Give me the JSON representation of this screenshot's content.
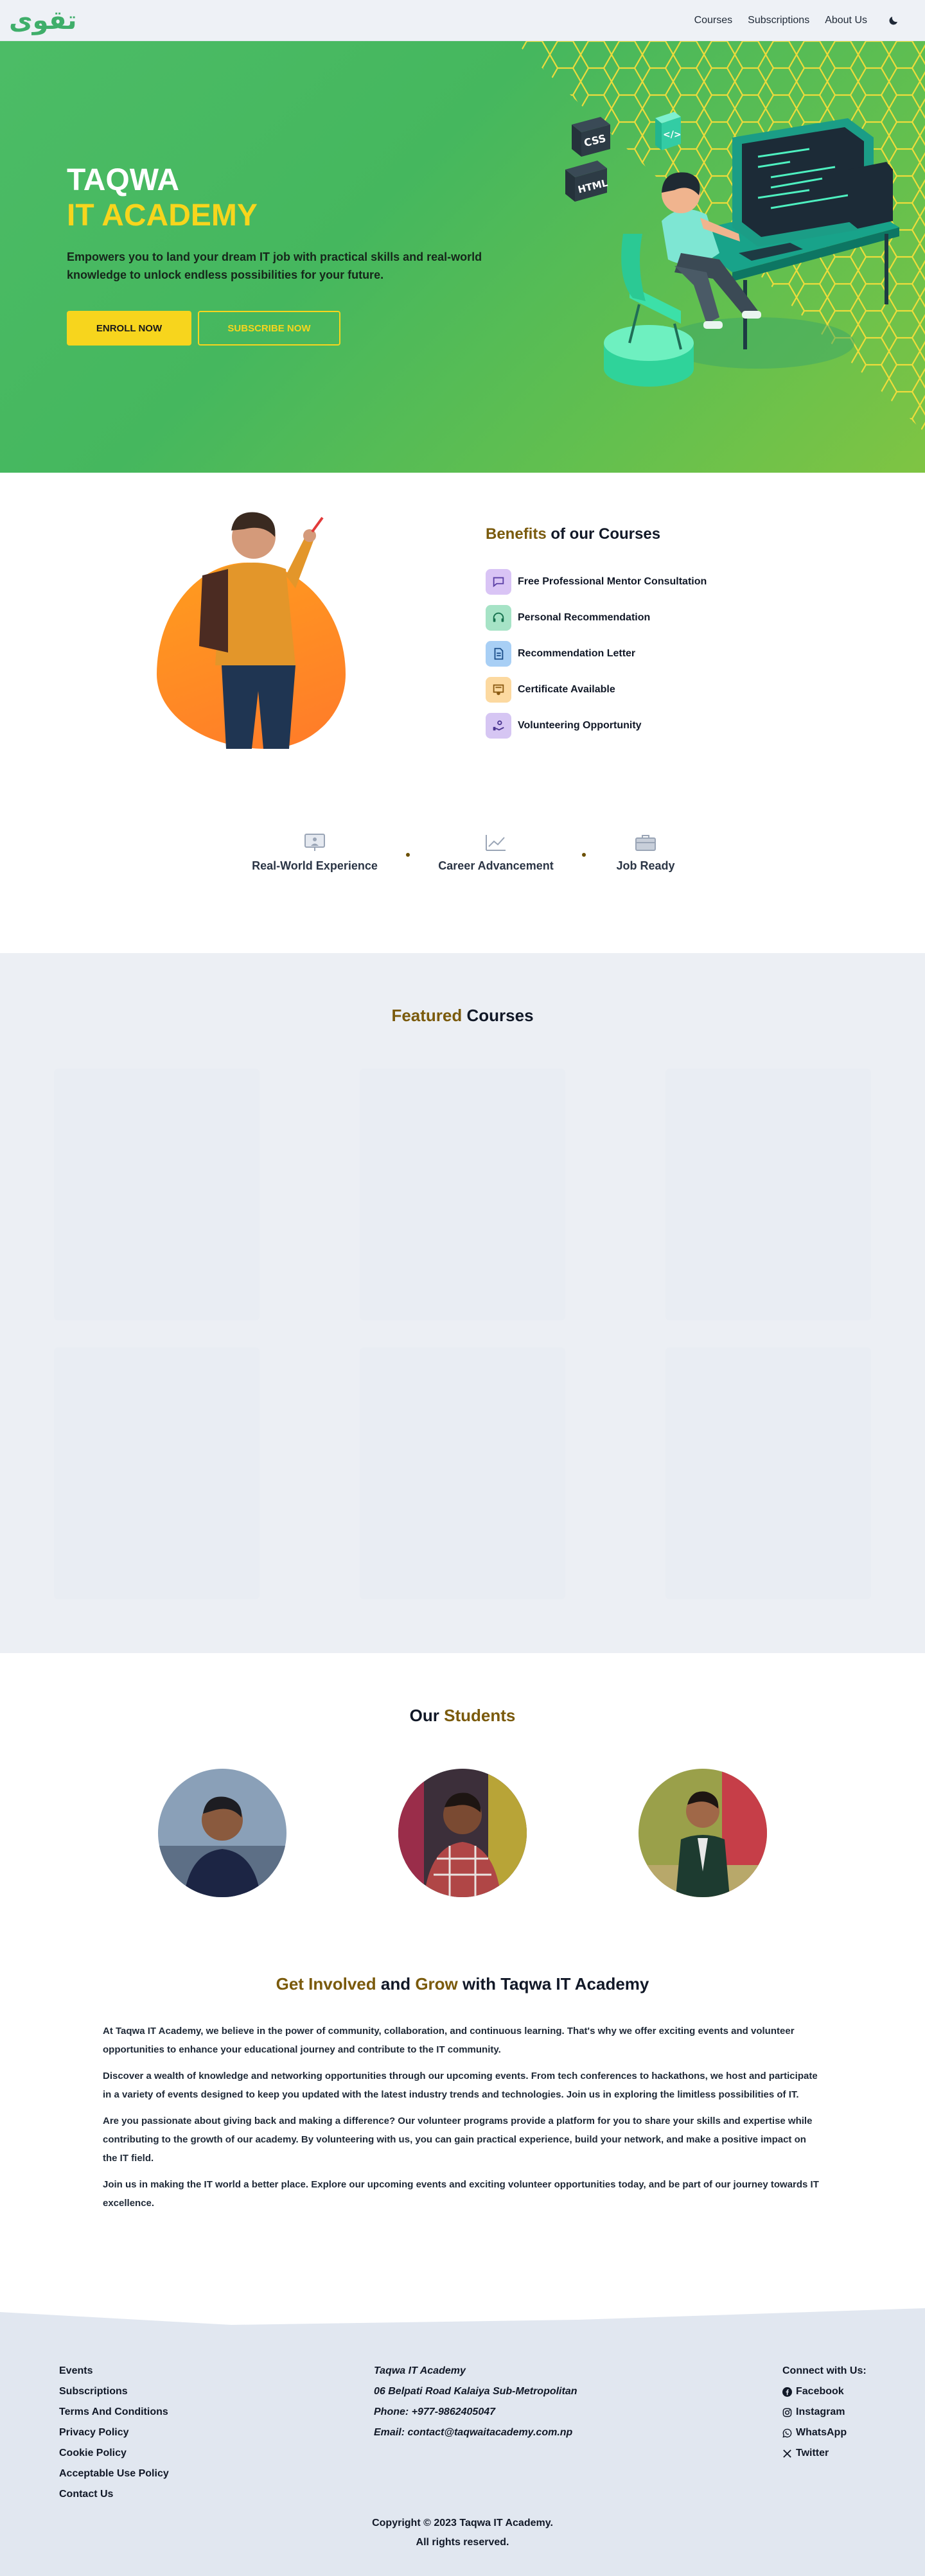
{
  "nav": {
    "logo_text": "تقوى",
    "links": [
      "Courses",
      "Subscriptions",
      "About Us"
    ],
    "theme_toggle_icon": "moon-icon"
  },
  "hero": {
    "title_line1": "TAQWA",
    "title_line2": "IT ACADEMY",
    "description": "Empowers you to land your dream IT job with practical skills and real-world knowledge to unlock endless possibilities for your future.",
    "enroll_label": "ENROLL NOW",
    "subscribe_label": "SUBSCRIBE NOW",
    "illustration_labels": [
      "CSS",
      "HTML",
      "</>"
    ]
  },
  "benefits": {
    "title_accent": "Benefits",
    "title_rest": " of our Courses",
    "items": [
      {
        "label": "Free Professional Mentor Consultation",
        "icon": "chat-icon",
        "color": "#d9c4f5"
      },
      {
        "label": "Personal Recommendation",
        "icon": "headset-icon",
        "color": "#a6e3c6"
      },
      {
        "label": "Recommendation Letter",
        "icon": "document-icon",
        "color": "#a8cff5"
      },
      {
        "label": "Certificate Available",
        "icon": "certificate-icon",
        "color": "#fcd9a0"
      },
      {
        "label": "Volunteering Opportunity",
        "icon": "volunteer-icon",
        "color": "#d6c6f3"
      }
    ]
  },
  "features": [
    {
      "label": "Real-World Experience",
      "icon": "presentation-icon"
    },
    {
      "label": "Career Advancement",
      "icon": "trending-up-icon"
    },
    {
      "label": "Job Ready",
      "icon": "briefcase-icon"
    }
  ],
  "courses": {
    "title_accent": "Featured",
    "title_rest": " Courses"
  },
  "students": {
    "title_plain": "Our ",
    "title_accent": "Students"
  },
  "involved": {
    "title_a": "Get Involved",
    "title_and": " and ",
    "title_b": "Grow",
    "title_rest": " with Taqwa IT Academy",
    "paragraphs": [
      "At Taqwa IT Academy, we believe in the power of community, collaboration, and continuous learning. That's why we offer exciting events and volunteer opportunities to enhance your educational journey and contribute to the IT community.",
      "Discover a wealth of knowledge and networking opportunities through our upcoming events. From tech conferences to hackathons, we host and participate in a variety of events designed to keep you updated with the latest industry trends and technologies. Join us in exploring the limitless possibilities of IT.",
      "Are you passionate about giving back and making a difference? Our volunteer programs provide a platform for you to share your skills and expertise while contributing to the growth of our academy. By volunteering with us, you can gain practical experience, build your network, and make a positive impact on the IT field.",
      "Join us in making the IT world a better place. Explore our upcoming events and exciting volunteer opportunities today, and be part of our journey towards IT excellence."
    ]
  },
  "footer": {
    "links": [
      "Events",
      "Subscriptions",
      "Terms And Conditions",
      "Privacy Policy",
      "Cookie Policy",
      "Acceptable Use Policy",
      "Contact Us"
    ],
    "org_name": "Taqwa IT Academy",
    "address": "06 Belpati Road Kalaiya Sub-Metropolitan",
    "phone": "Phone: +977-9862405047",
    "email": "Email: contact@taqwaitacademy.com.np",
    "connect_title": "Connect with Us:",
    "social": [
      {
        "label": "Facebook",
        "icon": "facebook-icon"
      },
      {
        "label": "Instagram",
        "icon": "instagram-icon"
      },
      {
        "label": "WhatsApp",
        "icon": "whatsapp-icon"
      },
      {
        "label": "Twitter",
        "icon": "x-twitter-icon"
      }
    ],
    "copyright": "Copyright © 2023 Taqwa IT Academy.",
    "rights": "All rights reserved."
  },
  "colors": {
    "brand_green": "#45b75e",
    "accent_yellow": "#f7d51d",
    "accent_gold": "#7a5a0c",
    "footer_bg": "#e1e7f0"
  }
}
